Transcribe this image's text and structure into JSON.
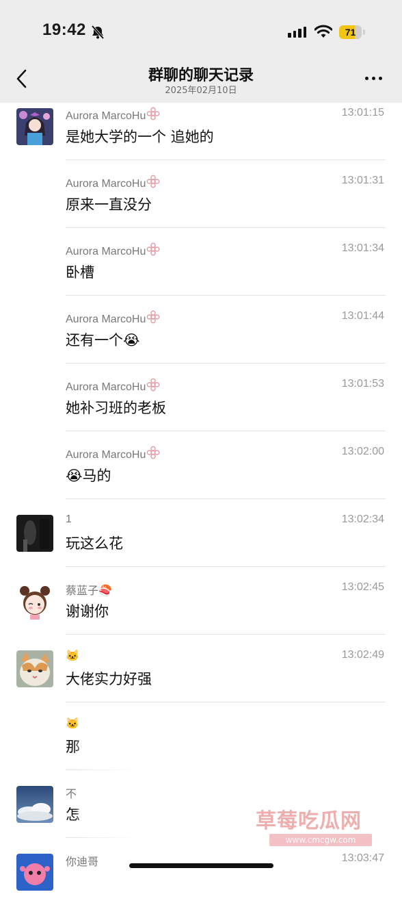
{
  "status": {
    "time": "19:42",
    "battery": "71",
    "battery_level": 0.71
  },
  "header": {
    "title": "群聊的聊天记录",
    "date": "2025年02月10日"
  },
  "messages": [
    {
      "name": "Aurora MarcoHu",
      "time": "13:01:15",
      "text": "是她大学的一个 追她的",
      "avatar": "anime-girl"
    },
    {
      "name": "Aurora MarcoHu",
      "time": "13:01:31",
      "text": "原来一直没分",
      "avatar": ""
    },
    {
      "name": "Aurora MarcoHu",
      "time": "13:01:34",
      "text": "卧槽",
      "avatar": ""
    },
    {
      "name": "Aurora MarcoHu",
      "time": "13:01:44",
      "text": "还有一个😭",
      "avatar": ""
    },
    {
      "name": "Aurora MarcoHu",
      "time": "13:01:53",
      "text": "她补习班的老板",
      "avatar": ""
    },
    {
      "name": "Aurora MarcoHu",
      "time": "13:02:00",
      "text": "😭马的",
      "avatar": ""
    },
    {
      "name": "1",
      "time": "13:02:34",
      "text": "玩这么花",
      "avatar": "dark-photo"
    },
    {
      "name": "蔡蓝子🍣",
      "time": "13:02:45",
      "text": "谢谢你",
      "avatar": "cartoon-girl"
    },
    {
      "name": "🐱",
      "time": "13:02:49",
      "text": "大佬实力好强",
      "avatar": "cat-photo"
    },
    {
      "name": "🐱",
      "time": "",
      "text": "那",
      "avatar": ""
    },
    {
      "name": "不",
      "time": "",
      "text": "怎",
      "avatar": "sky-photo"
    },
    {
      "name": "你迪哥",
      "time": "13:03:47",
      "text": "",
      "avatar": "pink-character"
    }
  ],
  "watermark": {
    "text": "草莓吃瓜网",
    "url": "www.cmcgw.com"
  },
  "colors": {
    "header_bg": "#ededed",
    "battery": "#f2c511",
    "name_badge": "#e8a0a8"
  }
}
